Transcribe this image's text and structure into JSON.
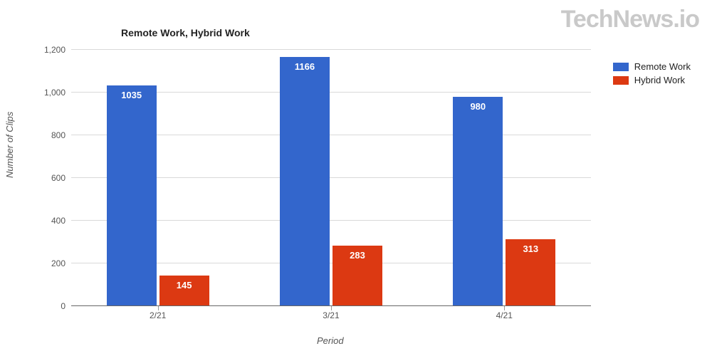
{
  "watermark": "TechNews.io",
  "chart_data": {
    "type": "bar",
    "title": "Remote Work, Hybrid Work",
    "xlabel": "Period",
    "ylabel": "Number of Clips",
    "ylim": [
      0,
      1200
    ],
    "y_ticks": [
      0,
      200,
      400,
      600,
      800,
      1000,
      1200
    ],
    "y_tick_labels": [
      "0",
      "200",
      "400",
      "600",
      "800",
      "1,000",
      "1,200"
    ],
    "categories": [
      "2/21",
      "3/21",
      "4/21"
    ],
    "series": [
      {
        "name": "Remote Work",
        "color": "#3366cc",
        "values": [
          1035,
          1166,
          980
        ]
      },
      {
        "name": "Hybrid Work",
        "color": "#dc3912",
        "values": [
          145,
          283,
          313
        ]
      }
    ],
    "legend_position": "right",
    "grid": true
  }
}
